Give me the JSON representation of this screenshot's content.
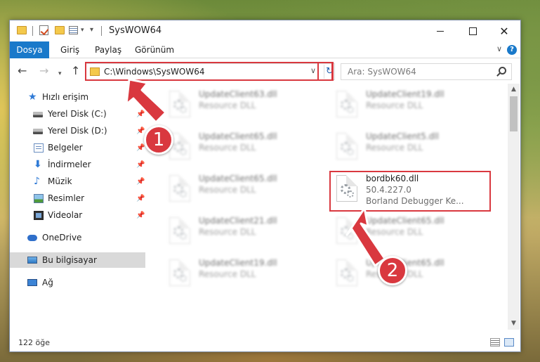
{
  "window": {
    "title": "SysWOW64"
  },
  "ribbon": {
    "tabs": [
      "Dosya",
      "Giriş",
      "Paylaş",
      "Görünüm"
    ],
    "help": "?"
  },
  "address": {
    "path": "C:\\Windows\\SysWOW64",
    "search_placeholder": "Ara: SysWOW64"
  },
  "sidebar": {
    "items": [
      {
        "label": "Hızlı erişim",
        "icon": "star-icon"
      },
      {
        "label": "Yerel Disk (C:)",
        "icon": "drive-icon",
        "pinned": true
      },
      {
        "label": "Yerel Disk (D:)",
        "icon": "drive-icon",
        "pinned": true
      },
      {
        "label": "Belgeler",
        "icon": "documents-icon",
        "pinned": true
      },
      {
        "label": "İndirmeler",
        "icon": "downloads-icon",
        "pinned": true
      },
      {
        "label": "Müzik",
        "icon": "music-icon",
        "pinned": true
      },
      {
        "label": "Resimler",
        "icon": "pictures-icon",
        "pinned": true
      },
      {
        "label": "Videolar",
        "icon": "videos-icon",
        "pinned": true
      },
      {
        "label": "OneDrive",
        "icon": "onedrive-icon"
      },
      {
        "label": "Bu bilgisayar",
        "icon": "computer-icon",
        "selected": true
      },
      {
        "label": "Ağ",
        "icon": "network-icon"
      }
    ]
  },
  "files": [
    {
      "name": "UpdateClient63.dll",
      "line2": "Resource DLL",
      "blurred": true
    },
    {
      "name": "UpdateClient19.dll",
      "line2": "Resource DLL",
      "blurred": true
    },
    {
      "name": "UpdateClient65.dll",
      "line2": "Resource DLL",
      "blurred": true
    },
    {
      "name": "UpdateClient5.dll",
      "line2": "Resource DLL",
      "blurred": true
    },
    {
      "name": "UpdateClient65.dll",
      "line2": "Resource DLL",
      "blurred": true
    },
    {
      "name": "bordbk60.dll",
      "line2": "50.4.227.0",
      "line3": "Borland Debugger Ke...",
      "blurred": false
    },
    {
      "name": "UpdateClient21.dll",
      "line2": "Resource DLL",
      "blurred": true
    },
    {
      "name": "UpdateClient65.dll",
      "line2": "Resource DLL",
      "blurred": true
    },
    {
      "name": "UpdateClient19.dll",
      "line2": "Resource DLL",
      "blurred": true
    },
    {
      "name": "UpdateClient65.dll",
      "line2": "Resource DLL",
      "blurred": true
    }
  ],
  "status": {
    "item_count": "122 öğe"
  },
  "annotations": {
    "step1": "1",
    "step2": "2",
    "color": "#d9383f"
  }
}
